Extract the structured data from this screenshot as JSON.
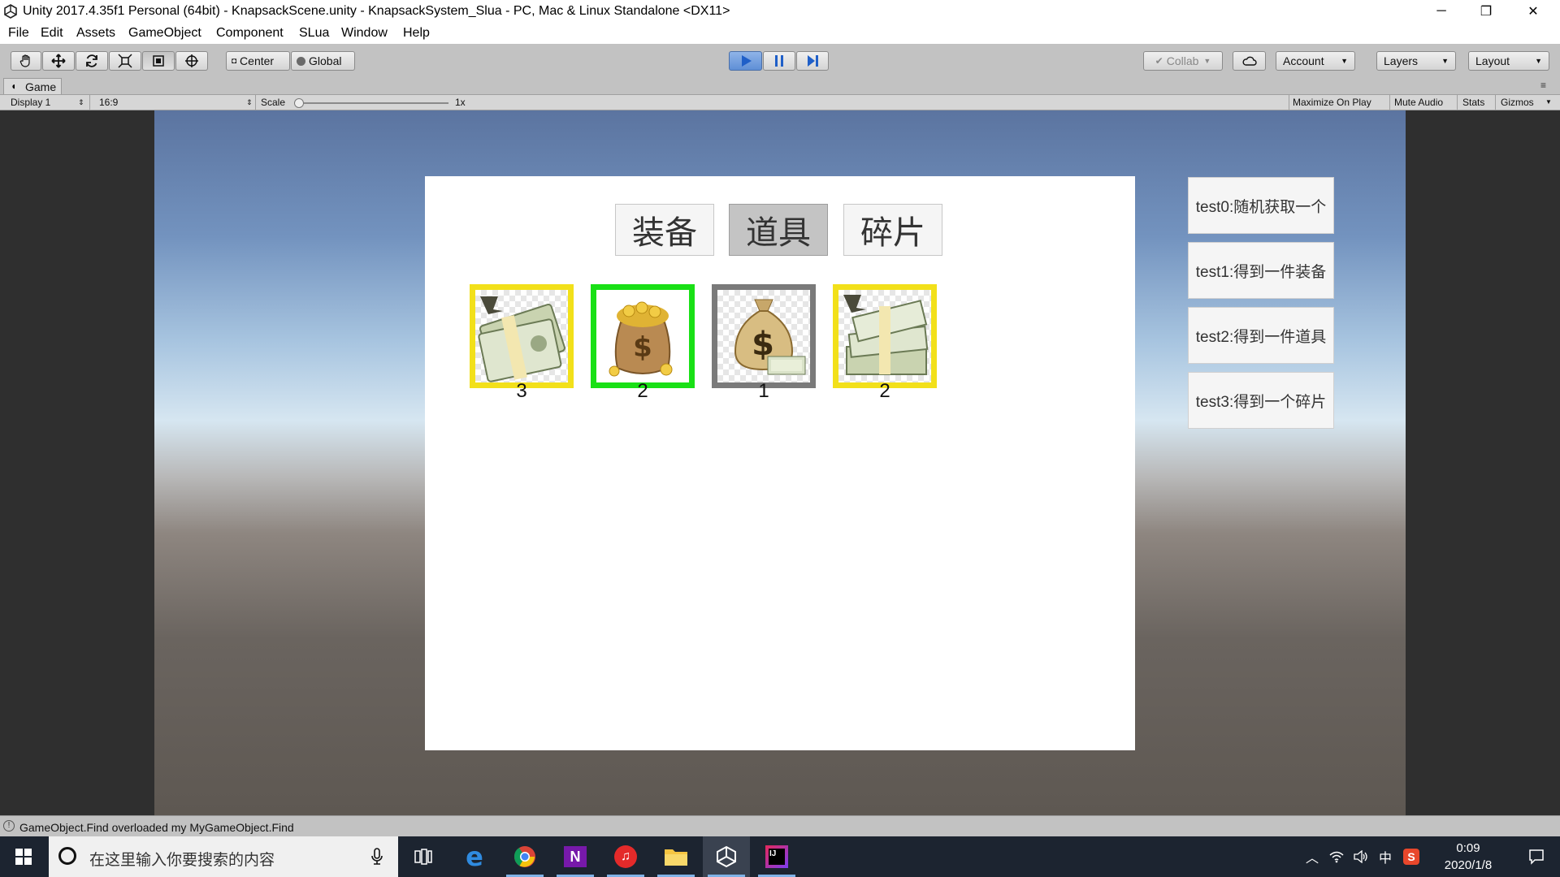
{
  "window": {
    "title": "Unity 2017.4.35f1 Personal (64bit) - KnapsackScene.unity - KnapsackSystem_Slua - PC, Mac & Linux Standalone <DX11>",
    "minimize": "─",
    "restore": "❐",
    "close": "✕"
  },
  "menu": [
    "File",
    "Edit",
    "Assets",
    "GameObject",
    "Component",
    "SLua",
    "Window",
    "Help"
  ],
  "toolbar": {
    "pivot_center": "Center",
    "pivot_global": "Global",
    "collab": "Collab",
    "account": "Account",
    "layers": "Layers",
    "layout": "Layout"
  },
  "game_tab": {
    "label": "Game",
    "display": "Display 1",
    "aspect": "16:9",
    "scale_label": "Scale",
    "scale_value": "1x",
    "maximize_on_play": "Maximize On Play",
    "mute_audio": "Mute Audio",
    "stats": "Stats",
    "gizmos": "Gizmos"
  },
  "knapsack": {
    "tabs": [
      {
        "label": "装备",
        "active": false
      },
      {
        "label": "道具",
        "active": true
      },
      {
        "label": "碎片",
        "active": false
      }
    ],
    "slots": [
      {
        "icon": "cash-bundle-icon",
        "count": "3",
        "border": "#f2e01a"
      },
      {
        "icon": "gold-coin-sack-icon",
        "count": "2",
        "border": "#19e016"
      },
      {
        "icon": "money-bag-icon",
        "count": "1",
        "border": "#7a7a7a"
      },
      {
        "icon": "cash-stack-icon",
        "count": "2",
        "border": "#f2e01a"
      }
    ]
  },
  "test_buttons": [
    "test0:随机获取一个",
    "test1:得到一件装备",
    "test2:得到一件道具",
    "test3:得到一个碎片"
  ],
  "status": {
    "message": "GameObject.Find overloaded my MyGameObject.Find"
  },
  "taskbar": {
    "search_placeholder": "在这里输入你要搜索的内容",
    "ime": "中",
    "time": "0:09",
    "date": "2020/1/8"
  }
}
